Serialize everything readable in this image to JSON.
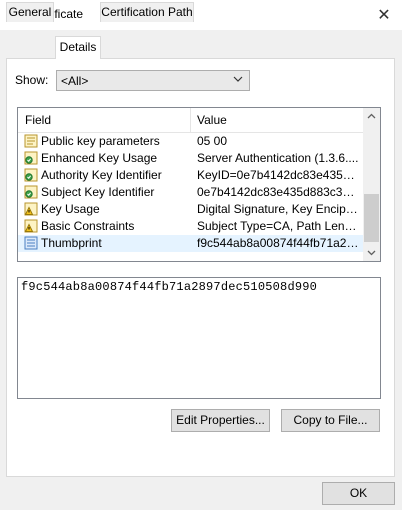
{
  "window": {
    "title": "Certificate",
    "close_glyph": "✕"
  },
  "tabs": [
    {
      "label": "General"
    },
    {
      "label": "Details"
    },
    {
      "label": "Certification Path"
    }
  ],
  "show": {
    "label": "Show:",
    "selected": "<All>"
  },
  "list": {
    "columns": {
      "field": "Field",
      "value": "Value"
    },
    "rows": [
      {
        "field": "Public key parameters",
        "value": "05 00",
        "icon": "certificate-field-icon"
      },
      {
        "field": "Enhanced Key Usage",
        "value": "Server Authentication (1.3.6....",
        "icon": "extension-icon"
      },
      {
        "field": "Authority Key Identifier",
        "value": "KeyID=0e7b4142dc83e435d8...",
        "icon": "extension-icon"
      },
      {
        "field": "Subject Key Identifier",
        "value": "0e7b4142dc83e435d883c33a...",
        "icon": "extension-icon"
      },
      {
        "field": "Key Usage",
        "value": "Digital Signature, Key Encipher...",
        "icon": "critical-extension-icon"
      },
      {
        "field": "Basic Constraints",
        "value": "Subject Type=CA, Path Lengt...",
        "icon": "critical-extension-icon"
      },
      {
        "field": "Thumbprint",
        "value": "f9c544ab8a00874f44fb71a28...",
        "icon": "property-icon"
      }
    ],
    "selected_row": 6
  },
  "detail": {
    "text": "f9c544ab8a00874f44fb71a2897dec510508d990"
  },
  "buttons": {
    "edit_properties": "Edit Properties...",
    "copy_to_file": "Copy to File...",
    "ok": "OK"
  }
}
